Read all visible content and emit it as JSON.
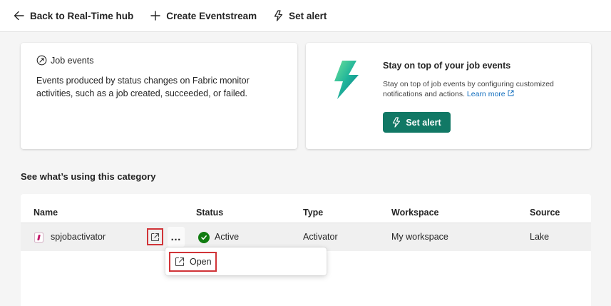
{
  "toolbar": {
    "back_label": "Back to Real-Time hub",
    "create_label": "Create Eventstream",
    "alert_label": "Set alert"
  },
  "info_card": {
    "label": "Job events",
    "description": "Events produced by status changes on Fabric monitor activities, such as a job created, succeeded, or failed."
  },
  "promo_card": {
    "title": "Stay on top of your job events",
    "description": "Stay on top of job events by configuring customized notifications and actions.",
    "link_text": "Learn more",
    "button_label": "Set alert",
    "accent_color": "#117865"
  },
  "section": {
    "title": "See what’s using this category"
  },
  "table": {
    "columns": [
      "Name",
      "Status",
      "Type",
      "Workspace",
      "Source"
    ],
    "rows": [
      {
        "name": "spjobactivator",
        "status": "Active",
        "type": "Activator",
        "workspace": "My workspace",
        "source": "Lake",
        "more_label": "…"
      }
    ]
  },
  "context_menu": {
    "items": [
      {
        "label": "Open",
        "icon": "open-external-icon"
      }
    ]
  },
  "colors": {
    "highlight_border": "#d13438",
    "status_active": "#107c10",
    "link": "#0f6cbd"
  }
}
